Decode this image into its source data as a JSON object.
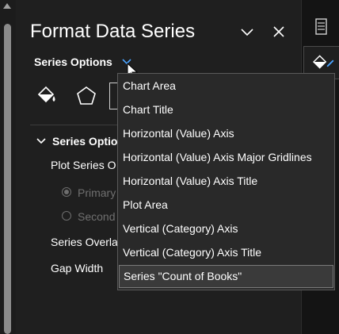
{
  "pane": {
    "title": "Format Data Series",
    "series_options_label": "Series Options",
    "section_label": "Series Optio",
    "plot_series_on_label": "Plot Series O",
    "primary_axis_label": "Primary",
    "secondary_axis_label": "Second",
    "series_overlap_label": "Series Overla",
    "gap_width_label": "Gap Width",
    "primary_selected": true
  },
  "dropdown": {
    "items": [
      "Chart Area",
      "Chart Title",
      "Horizontal (Value) Axis",
      "Horizontal (Value) Axis Major Gridlines",
      "Horizontal (Value) Axis Title",
      "Plot Area",
      "Vertical (Category) Axis",
      "Vertical (Category) Axis Title",
      "Series \"Count of Books\""
    ],
    "selected_index": 8
  },
  "icons": {
    "collapse": "chevron-down-icon",
    "close": "close-icon",
    "series_dropdown": "chevron-down-icon",
    "fill_line": "paint-bucket-icon",
    "effects": "pentagon-icon",
    "size_properties": "size-properties-icon",
    "rail_1": "document-icon",
    "rail_2": "paint-bucket-icon"
  },
  "colors": {
    "background": "#1f1f1f",
    "dropdown_bg": "#292929",
    "accent_chevron": "#4aa3ff",
    "disabled_text": "#707070"
  }
}
